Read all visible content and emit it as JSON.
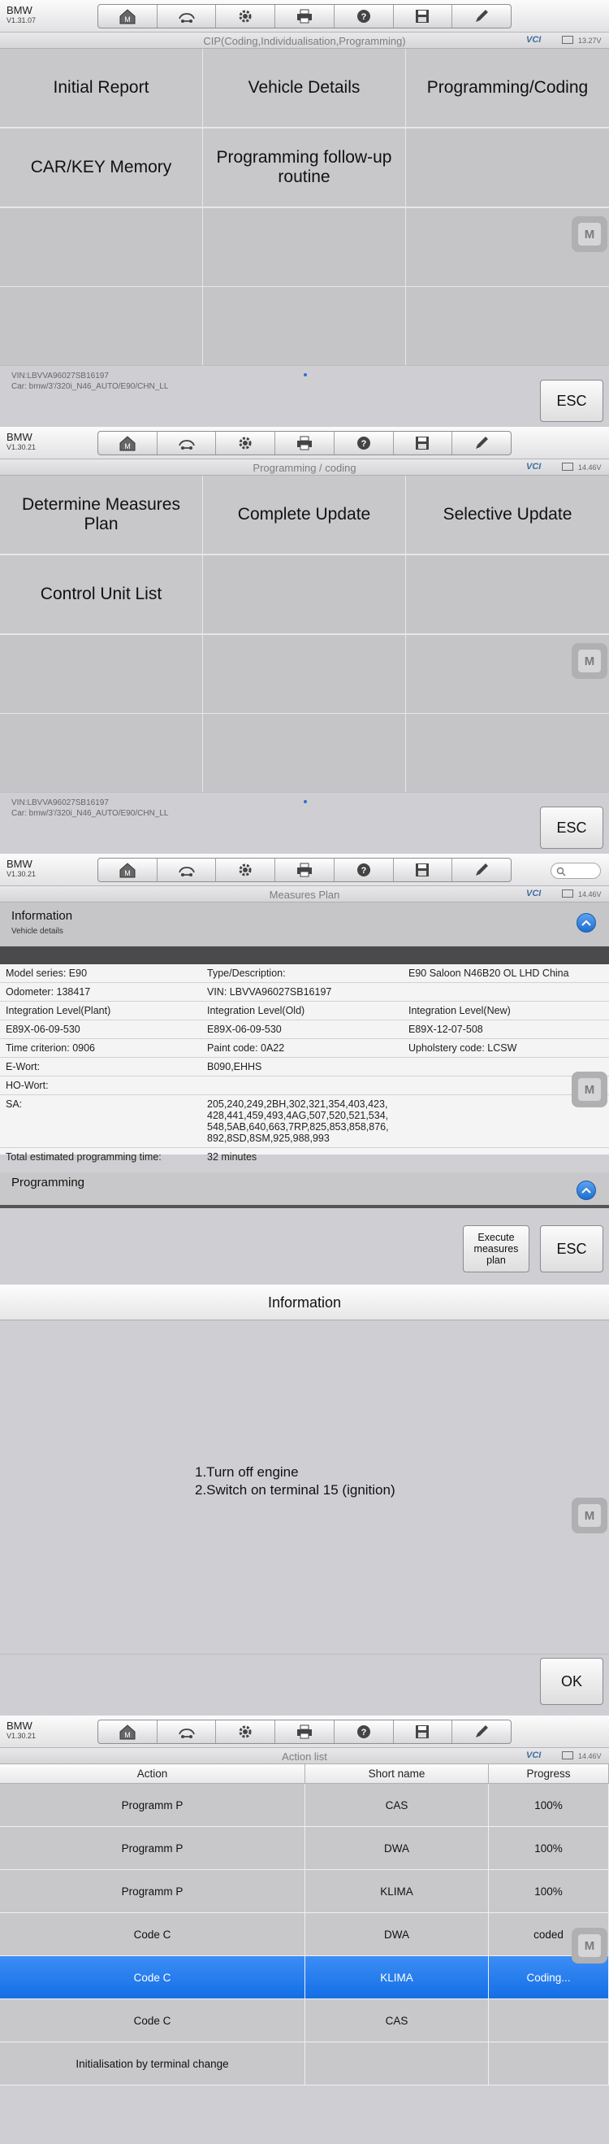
{
  "app": {
    "brand": "BMW"
  },
  "icons": [
    "home-icon",
    "car-icon",
    "gear-icon",
    "printer-icon",
    "help-icon",
    "save-icon",
    "pen-icon"
  ],
  "colors": {
    "accent": "#1e6fd0",
    "selected_row": "#2a7ff0",
    "vci": "#3f6f9f"
  },
  "screen1": {
    "version": "V1.31.07",
    "title": "CIP(Coding,Individualisation,Programming)",
    "voltage": "13.27V",
    "tiles": [
      "Initial Report",
      "Vehicle Details",
      "Programming/Coding",
      "CAR/KEY Memory",
      "Programming follow-up routine",
      "",
      "",
      "",
      "",
      "",
      "",
      ""
    ],
    "vin": "VIN:LBVVA96027SB16197",
    "car": "Car: bmw/3'/320i_N46_AUTO/E90/CHN_LL",
    "esc": "ESC"
  },
  "screen2": {
    "version": "V1.30.21",
    "title": "Programming / coding",
    "voltage": "14.46V",
    "tiles": [
      "Determine Measures Plan",
      "Complete Update",
      "Selective Update",
      "Control Unit List",
      "",
      "",
      "",
      "",
      "",
      "",
      "",
      ""
    ],
    "vin": "VIN:LBVVA96027SB16197",
    "car": "Car: bmw/3'/320i_N46_AUTO/E90/CHN_LL",
    "esc": "ESC"
  },
  "screen3": {
    "version": "V1.30.21",
    "title": "Measures Plan",
    "voltage": "14.46V",
    "info_title": "Information",
    "info_sub": "Vehicle details",
    "rows": [
      [
        "Model series: E90",
        "Type/Description:",
        "E90 Saloon N46B20 OL LHD China"
      ],
      [
        "Odometer: 138417",
        "VIN: LBVVA96027SB16197",
        ""
      ],
      [
        "Integration Level(Plant)",
        "Integration Level(Old)",
        "Integration Level(New)"
      ],
      [
        "E89X-06-09-530",
        "E89X-06-09-530",
        "E89X-12-07-508"
      ],
      [
        "Time criterion: 0906",
        "Paint code: 0A22",
        "Upholstery code: LCSW"
      ],
      [
        "E-Wort:",
        "B090,EHHS",
        ""
      ],
      [
        "HO-Wort:",
        "",
        ""
      ],
      [
        "SA:",
        "205,240,249,2BH,302,321,354,403,423,\n428,441,459,493,4AG,507,520,521,534,\n548,5AB,640,663,7RP,825,853,858,876,\n892,8SD,8SM,925,988,993",
        ""
      ],
      [
        "Total estimated programming time:",
        "32 minutes",
        ""
      ]
    ],
    "programming_title": "Programming",
    "execute_label": "Execute\nmeasures\nplan",
    "esc": "ESC"
  },
  "screen4": {
    "title": "Information",
    "line1": "1.Turn off engine",
    "line2": "2.Switch on terminal 15 (ignition)",
    "ok": "OK"
  },
  "screen5": {
    "version": "V1.30.21",
    "title": "Action list",
    "voltage": "14.46V",
    "headers": [
      "Action",
      "Short name",
      "Progress"
    ],
    "rows": [
      [
        "Programm P",
        "CAS",
        "100%"
      ],
      [
        "Programm P",
        "DWA",
        "100%"
      ],
      [
        "Programm P",
        "KLIMA",
        "100%"
      ],
      [
        "Code C",
        "DWA",
        "coded"
      ],
      [
        "Code C",
        "KLIMA",
        "Coding..."
      ],
      [
        "Code C",
        "CAS",
        ""
      ],
      [
        "Initialisation by terminal change",
        "",
        ""
      ]
    ],
    "selected_row": 4
  }
}
